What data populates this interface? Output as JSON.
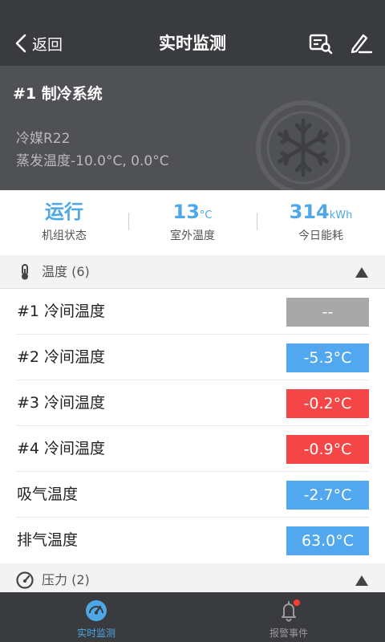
{
  "header": {
    "back_label": "返回",
    "title": "实时监测"
  },
  "system": {
    "name": "#1 制冷系统",
    "refrigerant": "冷媒R22",
    "evaporation": "蒸发温度-10.0°C, 0.0°C"
  },
  "stats": [
    {
      "value": "运行",
      "unit": "",
      "label": "机组状态"
    },
    {
      "value": "13",
      "unit": "°C",
      "label": "室外温度"
    },
    {
      "value": "314",
      "unit": "kWh",
      "label": "今日能耗"
    }
  ],
  "temperature_section": {
    "label": "温度 (6)",
    "icon": "thermometer-icon",
    "rows": [
      {
        "name": "#1 冷间温度",
        "value": "--",
        "status": "offline"
      },
      {
        "name": "#2 冷间温度",
        "value": "-5.3°C",
        "status": "normal"
      },
      {
        "name": "#3 冷间温度",
        "value": "-0.2°C",
        "status": "alarm"
      },
      {
        "name": "#4 冷间温度",
        "value": "-0.9°C",
        "status": "alarm"
      },
      {
        "name": "吸气温度",
        "value": "-2.7°C",
        "status": "normal"
      },
      {
        "name": "排气温度",
        "value": "63.0°C",
        "status": "normal"
      }
    ]
  },
  "pressure_section": {
    "label": "压力 (2)",
    "icon": "gauge-icon"
  },
  "tabs": [
    {
      "label": "实时监测",
      "icon": "gauge-icon",
      "active": true
    },
    {
      "label": "报警事件",
      "icon": "bell-icon",
      "active": false
    }
  ],
  "colors": {
    "accent": "#4ea7e6",
    "normal": "#52a8ee",
    "alarm": "#f44646",
    "offline": "#a8a8a8",
    "topbar": "#3a3b3e"
  }
}
